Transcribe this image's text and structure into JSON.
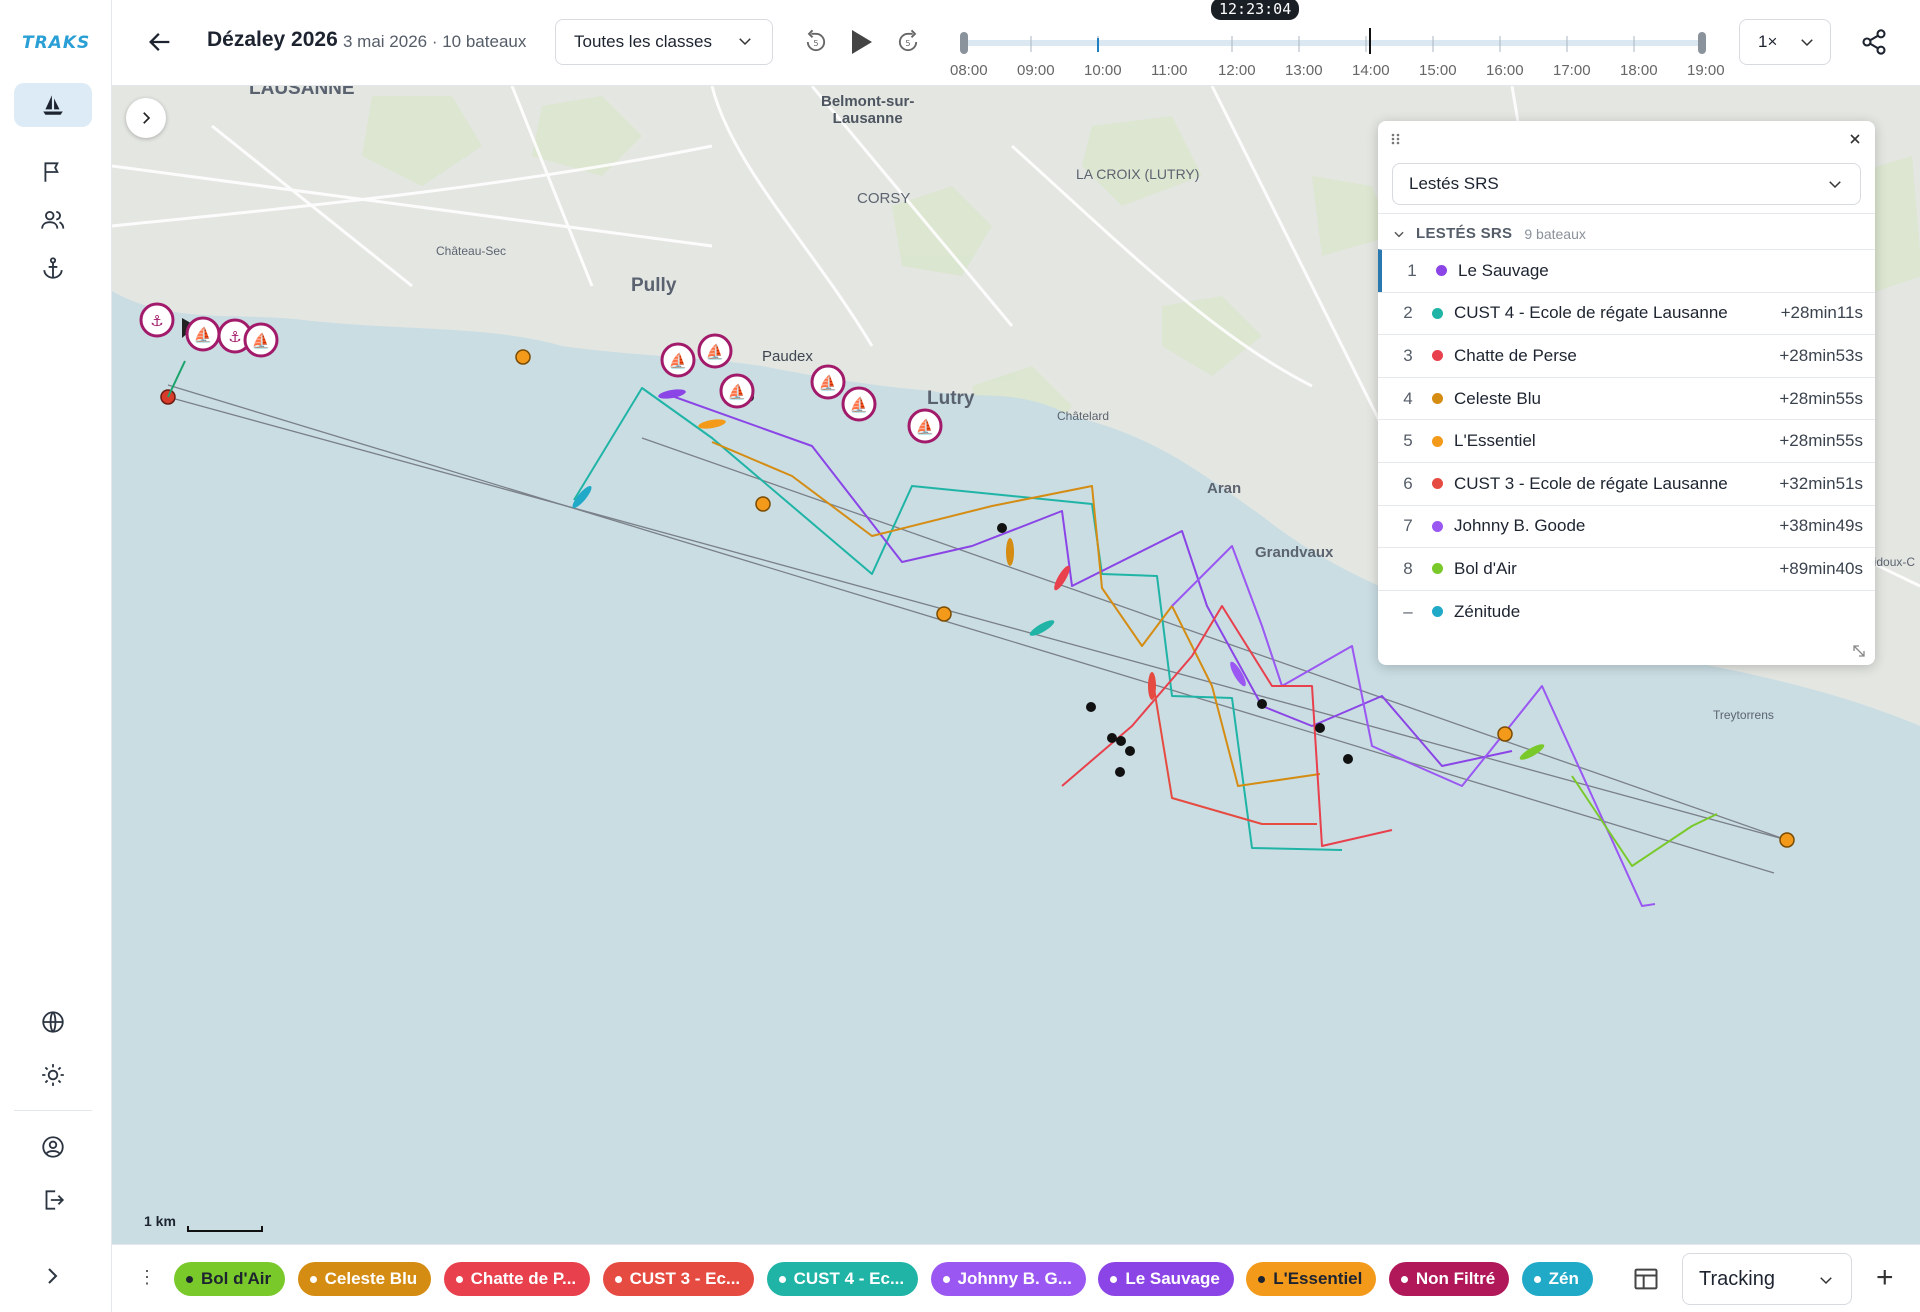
{
  "app": {
    "logo_text": "TRAKS"
  },
  "sidebar": {
    "items": [
      {
        "name": "boats",
        "icon": "sailboat-icon",
        "active": true
      },
      {
        "name": "flag",
        "icon": "flag-icon"
      },
      {
        "name": "users",
        "icon": "users-icon"
      },
      {
        "name": "anchor",
        "icon": "anchor-icon"
      },
      {
        "name": "globe",
        "icon": "globe-icon"
      },
      {
        "name": "theme",
        "icon": "sun-icon"
      },
      {
        "name": "account",
        "icon": "user-circle-icon"
      },
      {
        "name": "logout",
        "icon": "logout-icon"
      }
    ]
  },
  "header": {
    "title": "Dézaley 2026",
    "subtitle": "3 mai 2026 · 10 bateaux",
    "class_filter": "Toutes les classes",
    "speed": "1×",
    "current_time": "12:23:04",
    "timeline_ticks": [
      "08:00",
      "09:00",
      "10:00",
      "11:00",
      "12:00",
      "13:00",
      "14:00",
      "15:00",
      "16:00",
      "17:00",
      "18:00",
      "19:00"
    ]
  },
  "map": {
    "labels": {
      "lausanne": "LAUSANNE",
      "belmont": "Belmont-sur-\nLausanne",
      "corsy": "CORSY",
      "croix": "LA CROIX (LUTRY)",
      "chateau_sec": "Château-Sec",
      "pully": "Pully",
      "paudex": "Paudex",
      "lutry": "Lutry",
      "chatelard": "Châtelard",
      "aran": "Aran",
      "grandvaux": "Grandvaux",
      "treytorrens": "Treytorrens",
      "cuidoux": "uidoux-C"
    },
    "scale_label": "1 km",
    "colors": {
      "water": "#c9dde3",
      "land": "#ecedea",
      "le_sauvage": "#8b45e6",
      "cust4": "#1fb4a6",
      "chatte": "#e8404c",
      "celeste": "#d58c12",
      "lessentiel": "#f39a1b",
      "cust3": "#e64b41",
      "johnny": "#9a57f2",
      "bol": "#7ac92b",
      "zenitude": "#21a9c8",
      "marker": "#a21a6a"
    }
  },
  "ranking": {
    "class_select": "Lestés SRS",
    "group_title": "LESTÉS SRS",
    "group_count": "9 bateaux",
    "rows": [
      {
        "rank": "1",
        "name": "Le Sauvage",
        "delta": "",
        "color": "#8b45e6"
      },
      {
        "rank": "2",
        "name": "CUST 4 - Ecole de régate Lausanne",
        "delta": "+28min11s",
        "color": "#1fb4a6"
      },
      {
        "rank": "3",
        "name": "Chatte de Perse",
        "delta": "+28min53s",
        "color": "#e8404c"
      },
      {
        "rank": "4",
        "name": "Celeste Blu",
        "delta": "+28min55s",
        "color": "#d58c12"
      },
      {
        "rank": "5",
        "name": "L'Essentiel",
        "delta": "+28min55s",
        "color": "#f39a1b"
      },
      {
        "rank": "6",
        "name": "CUST 3 - Ecole de régate Lausanne",
        "delta": "+32min51s",
        "color": "#e64b41"
      },
      {
        "rank": "7",
        "name": "Johnny B. Goode",
        "delta": "+38min49s",
        "color": "#9a57f2"
      },
      {
        "rank": "8",
        "name": "Bol d'Air",
        "delta": "+89min40s",
        "color": "#7ac92b"
      },
      {
        "rank": "–",
        "name": "Zénitude",
        "delta": "",
        "color": "#21a9c8"
      }
    ]
  },
  "bottom": {
    "chips": [
      {
        "label": "Bol d'Air",
        "color": "#7ac92b",
        "dark": true
      },
      {
        "label": "Celeste Blu",
        "color": "#d58c12",
        "dark": false
      },
      {
        "label": "Chatte de P...",
        "color": "#e8404c",
        "dark": false
      },
      {
        "label": "CUST 3 - Ec...",
        "color": "#e64b41",
        "dark": false
      },
      {
        "label": "CUST 4 - Ec...",
        "color": "#1fb4a6",
        "dark": false
      },
      {
        "label": "Johnny B. G...",
        "color": "#9a57f2",
        "dark": false
      },
      {
        "label": "Le Sauvage",
        "color": "#8b45e6",
        "dark": false
      },
      {
        "label": "L'Essentiel",
        "color": "#f39a1b",
        "dark": true
      },
      {
        "label": "Non Filtré",
        "color": "#b0185a",
        "dark": false
      },
      {
        "label": "Zén",
        "color": "#21a9c8",
        "dark": false
      }
    ],
    "view_mode": "Tracking"
  }
}
